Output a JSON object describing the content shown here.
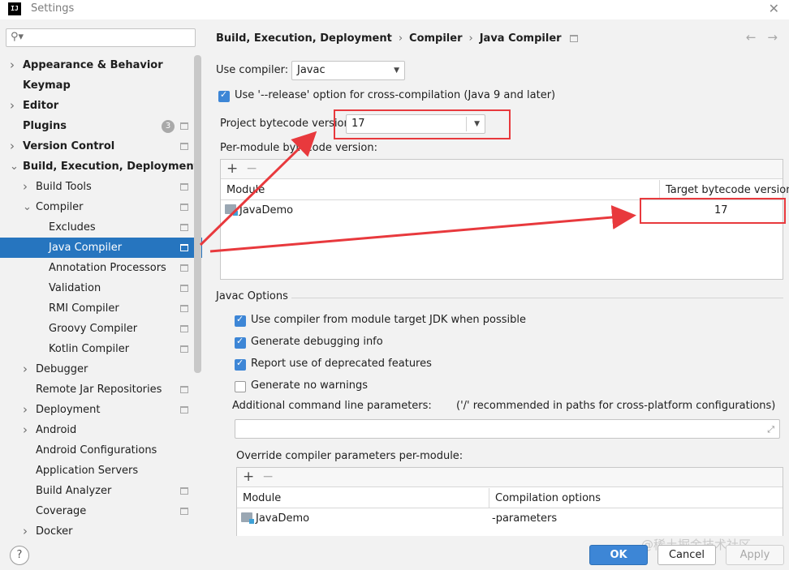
{
  "window": {
    "title": "Settings",
    "logo": "IJ"
  },
  "sidebar": {
    "search": {
      "placeholder": "",
      "value": ""
    },
    "items": [
      {
        "label": "Appearance & Behavior",
        "level": 0,
        "bold": true,
        "expandable": true,
        "expanded": false,
        "project_icon": false
      },
      {
        "label": "Keymap",
        "level": 0,
        "bold": true,
        "expandable": false,
        "project_icon": false
      },
      {
        "label": "Editor",
        "level": 0,
        "bold": true,
        "expandable": true,
        "expanded": false,
        "project_icon": false
      },
      {
        "label": "Plugins",
        "level": 0,
        "bold": true,
        "expandable": false,
        "project_icon": true,
        "badge": "3"
      },
      {
        "label": "Version Control",
        "level": 0,
        "bold": true,
        "expandable": true,
        "expanded": false,
        "project_icon": true
      },
      {
        "label": "Build, Execution, Deployment",
        "level": 0,
        "bold": true,
        "expandable": true,
        "expanded": true,
        "project_icon": false
      },
      {
        "label": "Build Tools",
        "level": 1,
        "bold": false,
        "expandable": true,
        "expanded": false,
        "project_icon": true
      },
      {
        "label": "Compiler",
        "level": 1,
        "bold": false,
        "expandable": true,
        "expanded": true,
        "project_icon": true
      },
      {
        "label": "Excludes",
        "level": 2,
        "bold": false,
        "expandable": false,
        "project_icon": true
      },
      {
        "label": "Java Compiler",
        "level": 2,
        "bold": false,
        "expandable": false,
        "project_icon": true,
        "selected": true
      },
      {
        "label": "Annotation Processors",
        "level": 2,
        "bold": false,
        "expandable": false,
        "project_icon": true
      },
      {
        "label": "Validation",
        "level": 2,
        "bold": false,
        "expandable": false,
        "project_icon": true
      },
      {
        "label": "RMI Compiler",
        "level": 2,
        "bold": false,
        "expandable": false,
        "project_icon": true
      },
      {
        "label": "Groovy Compiler",
        "level": 2,
        "bold": false,
        "expandable": false,
        "project_icon": true
      },
      {
        "label": "Kotlin Compiler",
        "level": 2,
        "bold": false,
        "expandable": false,
        "project_icon": true
      },
      {
        "label": "Debugger",
        "level": 1,
        "bold": false,
        "expandable": true,
        "expanded": false,
        "project_icon": false
      },
      {
        "label": "Remote Jar Repositories",
        "level": 1,
        "bold": false,
        "expandable": false,
        "project_icon": true
      },
      {
        "label": "Deployment",
        "level": 1,
        "bold": false,
        "expandable": true,
        "expanded": false,
        "project_icon": true
      },
      {
        "label": "Android",
        "level": 1,
        "bold": false,
        "expandable": true,
        "expanded": false,
        "project_icon": false
      },
      {
        "label": "Android Configurations",
        "level": 1,
        "bold": false,
        "expandable": false,
        "project_icon": false
      },
      {
        "label": "Application Servers",
        "level": 1,
        "bold": false,
        "expandable": false,
        "project_icon": false
      },
      {
        "label": "Build Analyzer",
        "level": 1,
        "bold": false,
        "expandable": false,
        "project_icon": true
      },
      {
        "label": "Coverage",
        "level": 1,
        "bold": false,
        "expandable": false,
        "project_icon": true
      },
      {
        "label": "Docker",
        "level": 1,
        "bold": false,
        "expandable": true,
        "expanded": false,
        "project_icon": false
      }
    ]
  },
  "breadcrumb": [
    "Build, Execution, Deployment",
    "Compiler",
    "Java Compiler"
  ],
  "form": {
    "use_compiler_label": "Use compiler:",
    "use_compiler_value": "Javac",
    "release_option_label": "Use '--release' option for cross-compilation (Java 9 and later)",
    "release_option_checked": true,
    "bytecode_version_label": "Project bytecode version:",
    "bytecode_version_value": "17",
    "per_module_label": "Per-module bytecode version:",
    "per_module_table": {
      "headers": [
        "Module",
        "Target bytecode version"
      ],
      "rows": [
        {
          "module": "JavaDemo",
          "target": "17"
        }
      ]
    },
    "javac_section": "Javac Options",
    "javac_options": [
      {
        "label": "Use compiler from module target JDK when possible",
        "checked": true
      },
      {
        "label": "Generate debugging info",
        "checked": true
      },
      {
        "label": "Report use of deprecated features",
        "checked": true
      },
      {
        "label": "Generate no warnings",
        "checked": false
      }
    ],
    "additional_params_label": "Additional command line parameters:",
    "additional_params_hint": "('/' recommended in paths for cross-platform configurations)",
    "additional_params_value": "",
    "override_label": "Override compiler parameters per-module:",
    "override_table": {
      "headers": [
        "Module",
        "Compilation options"
      ],
      "rows": [
        {
          "module": "JavaDemo",
          "options": "-parameters"
        }
      ]
    }
  },
  "buttons": {
    "help": "?",
    "ok": "OK",
    "cancel": "Cancel",
    "apply": "Apply"
  },
  "watermark": "@稀土掘金技术社区",
  "colors": {
    "selection": "#2675bf",
    "accent": "#3d86d6",
    "annotation": "#e8393d"
  }
}
